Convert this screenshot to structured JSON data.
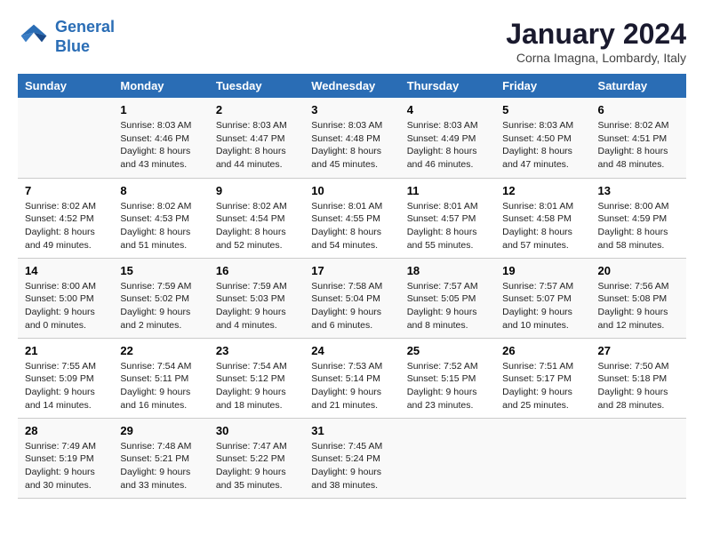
{
  "header": {
    "logo_line1": "General",
    "logo_line2": "Blue",
    "month_title": "January 2024",
    "location": "Corna Imagna, Lombardy, Italy"
  },
  "days_of_week": [
    "Sunday",
    "Monday",
    "Tuesday",
    "Wednesday",
    "Thursday",
    "Friday",
    "Saturday"
  ],
  "weeks": [
    [
      {
        "day": "",
        "info": ""
      },
      {
        "day": "1",
        "info": "Sunrise: 8:03 AM\nSunset: 4:46 PM\nDaylight: 8 hours\nand 43 minutes."
      },
      {
        "day": "2",
        "info": "Sunrise: 8:03 AM\nSunset: 4:47 PM\nDaylight: 8 hours\nand 44 minutes."
      },
      {
        "day": "3",
        "info": "Sunrise: 8:03 AM\nSunset: 4:48 PM\nDaylight: 8 hours\nand 45 minutes."
      },
      {
        "day": "4",
        "info": "Sunrise: 8:03 AM\nSunset: 4:49 PM\nDaylight: 8 hours\nand 46 minutes."
      },
      {
        "day": "5",
        "info": "Sunrise: 8:03 AM\nSunset: 4:50 PM\nDaylight: 8 hours\nand 47 minutes."
      },
      {
        "day": "6",
        "info": "Sunrise: 8:02 AM\nSunset: 4:51 PM\nDaylight: 8 hours\nand 48 minutes."
      }
    ],
    [
      {
        "day": "7",
        "info": "Sunrise: 8:02 AM\nSunset: 4:52 PM\nDaylight: 8 hours\nand 49 minutes."
      },
      {
        "day": "8",
        "info": "Sunrise: 8:02 AM\nSunset: 4:53 PM\nDaylight: 8 hours\nand 51 minutes."
      },
      {
        "day": "9",
        "info": "Sunrise: 8:02 AM\nSunset: 4:54 PM\nDaylight: 8 hours\nand 52 minutes."
      },
      {
        "day": "10",
        "info": "Sunrise: 8:01 AM\nSunset: 4:55 PM\nDaylight: 8 hours\nand 54 minutes."
      },
      {
        "day": "11",
        "info": "Sunrise: 8:01 AM\nSunset: 4:57 PM\nDaylight: 8 hours\nand 55 minutes."
      },
      {
        "day": "12",
        "info": "Sunrise: 8:01 AM\nSunset: 4:58 PM\nDaylight: 8 hours\nand 57 minutes."
      },
      {
        "day": "13",
        "info": "Sunrise: 8:00 AM\nSunset: 4:59 PM\nDaylight: 8 hours\nand 58 minutes."
      }
    ],
    [
      {
        "day": "14",
        "info": "Sunrise: 8:00 AM\nSunset: 5:00 PM\nDaylight: 9 hours\nand 0 minutes."
      },
      {
        "day": "15",
        "info": "Sunrise: 7:59 AM\nSunset: 5:02 PM\nDaylight: 9 hours\nand 2 minutes."
      },
      {
        "day": "16",
        "info": "Sunrise: 7:59 AM\nSunset: 5:03 PM\nDaylight: 9 hours\nand 4 minutes."
      },
      {
        "day": "17",
        "info": "Sunrise: 7:58 AM\nSunset: 5:04 PM\nDaylight: 9 hours\nand 6 minutes."
      },
      {
        "day": "18",
        "info": "Sunrise: 7:57 AM\nSunset: 5:05 PM\nDaylight: 9 hours\nand 8 minutes."
      },
      {
        "day": "19",
        "info": "Sunrise: 7:57 AM\nSunset: 5:07 PM\nDaylight: 9 hours\nand 10 minutes."
      },
      {
        "day": "20",
        "info": "Sunrise: 7:56 AM\nSunset: 5:08 PM\nDaylight: 9 hours\nand 12 minutes."
      }
    ],
    [
      {
        "day": "21",
        "info": "Sunrise: 7:55 AM\nSunset: 5:09 PM\nDaylight: 9 hours\nand 14 minutes."
      },
      {
        "day": "22",
        "info": "Sunrise: 7:54 AM\nSunset: 5:11 PM\nDaylight: 9 hours\nand 16 minutes."
      },
      {
        "day": "23",
        "info": "Sunrise: 7:54 AM\nSunset: 5:12 PM\nDaylight: 9 hours\nand 18 minutes."
      },
      {
        "day": "24",
        "info": "Sunrise: 7:53 AM\nSunset: 5:14 PM\nDaylight: 9 hours\nand 21 minutes."
      },
      {
        "day": "25",
        "info": "Sunrise: 7:52 AM\nSunset: 5:15 PM\nDaylight: 9 hours\nand 23 minutes."
      },
      {
        "day": "26",
        "info": "Sunrise: 7:51 AM\nSunset: 5:17 PM\nDaylight: 9 hours\nand 25 minutes."
      },
      {
        "day": "27",
        "info": "Sunrise: 7:50 AM\nSunset: 5:18 PM\nDaylight: 9 hours\nand 28 minutes."
      }
    ],
    [
      {
        "day": "28",
        "info": "Sunrise: 7:49 AM\nSunset: 5:19 PM\nDaylight: 9 hours\nand 30 minutes."
      },
      {
        "day": "29",
        "info": "Sunrise: 7:48 AM\nSunset: 5:21 PM\nDaylight: 9 hours\nand 33 minutes."
      },
      {
        "day": "30",
        "info": "Sunrise: 7:47 AM\nSunset: 5:22 PM\nDaylight: 9 hours\nand 35 minutes."
      },
      {
        "day": "31",
        "info": "Sunrise: 7:45 AM\nSunset: 5:24 PM\nDaylight: 9 hours\nand 38 minutes."
      },
      {
        "day": "",
        "info": ""
      },
      {
        "day": "",
        "info": ""
      },
      {
        "day": "",
        "info": ""
      }
    ]
  ]
}
